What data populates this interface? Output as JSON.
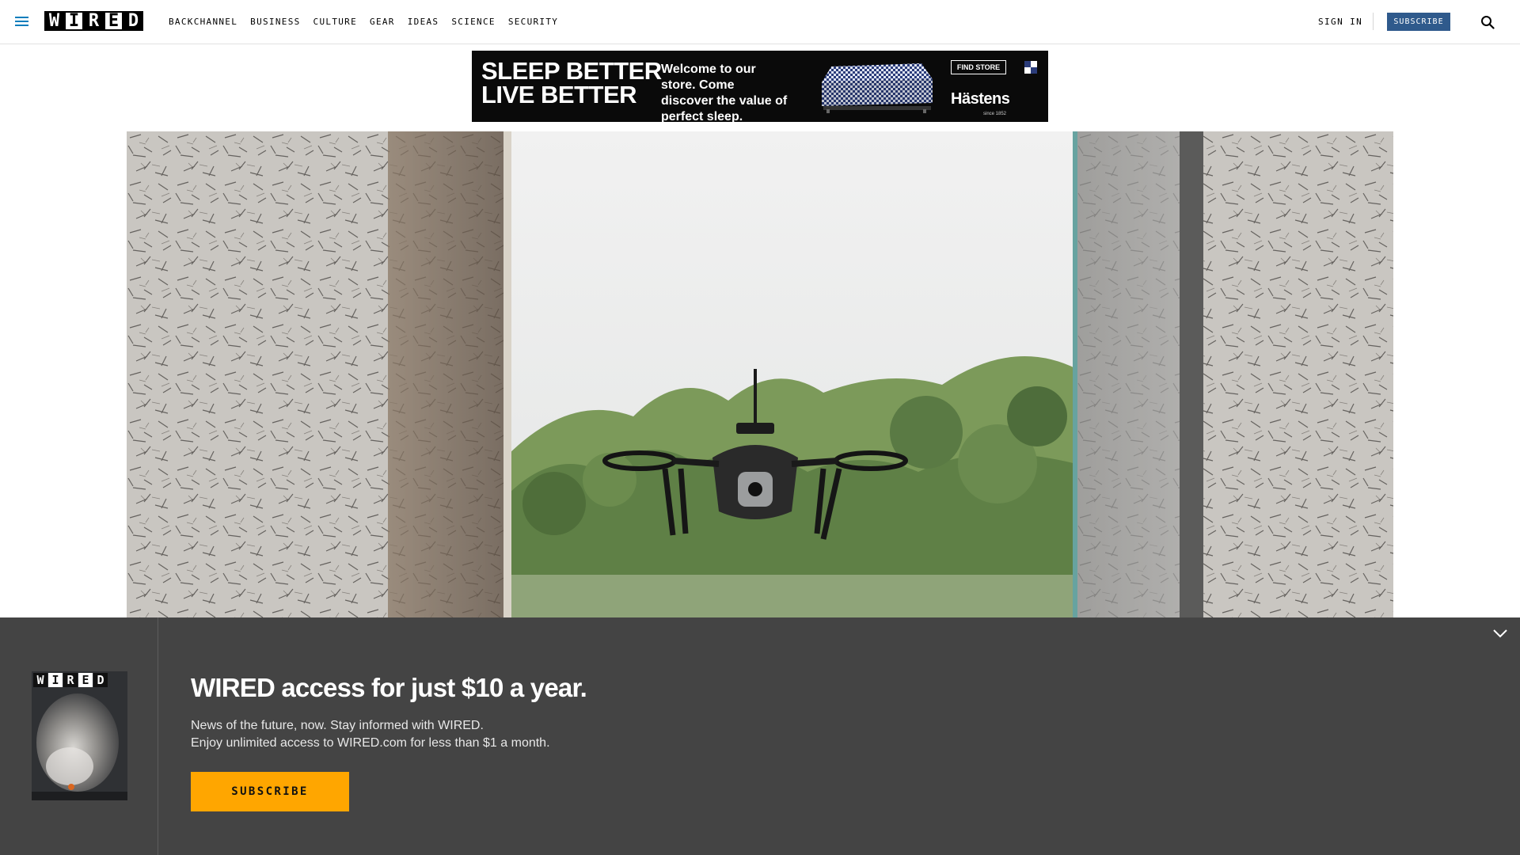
{
  "header": {
    "logo_letters": [
      "W",
      "I",
      "R",
      "E",
      "D"
    ],
    "nav": [
      "BACKCHANNEL",
      "BUSINESS",
      "CULTURE",
      "GEAR",
      "IDEAS",
      "SCIENCE",
      "SECURITY"
    ],
    "sign_in": "SIGN IN",
    "subscribe": "SUBSCRIBE",
    "icons": {
      "menu": "hamburger-menu-icon",
      "search": "search-icon"
    }
  },
  "ad": {
    "headline_line1": "SLEEP BETTER",
    "headline_line2": "LIVE BETTER",
    "body": "Welcome to our store. Come discover the value of perfect sleep.",
    "cta": "FIND STORE",
    "brand": "Hästens",
    "since": "since 1852"
  },
  "hero": {
    "subject": "drone-hovering-in-window-photo"
  },
  "paywall": {
    "cover_logo_letters": [
      "W",
      "I",
      "R",
      "E",
      "D"
    ],
    "title": "WIRED access for just $10 a year.",
    "line1": "News of the future, now. Stay informed with WIRED.",
    "line2": "Enjoy unlimited access to WIRED.com for less than $1 a month.",
    "subscribe": "SUBSCRIBE",
    "colors": {
      "background": "#444444",
      "button": "#ffa600"
    }
  }
}
